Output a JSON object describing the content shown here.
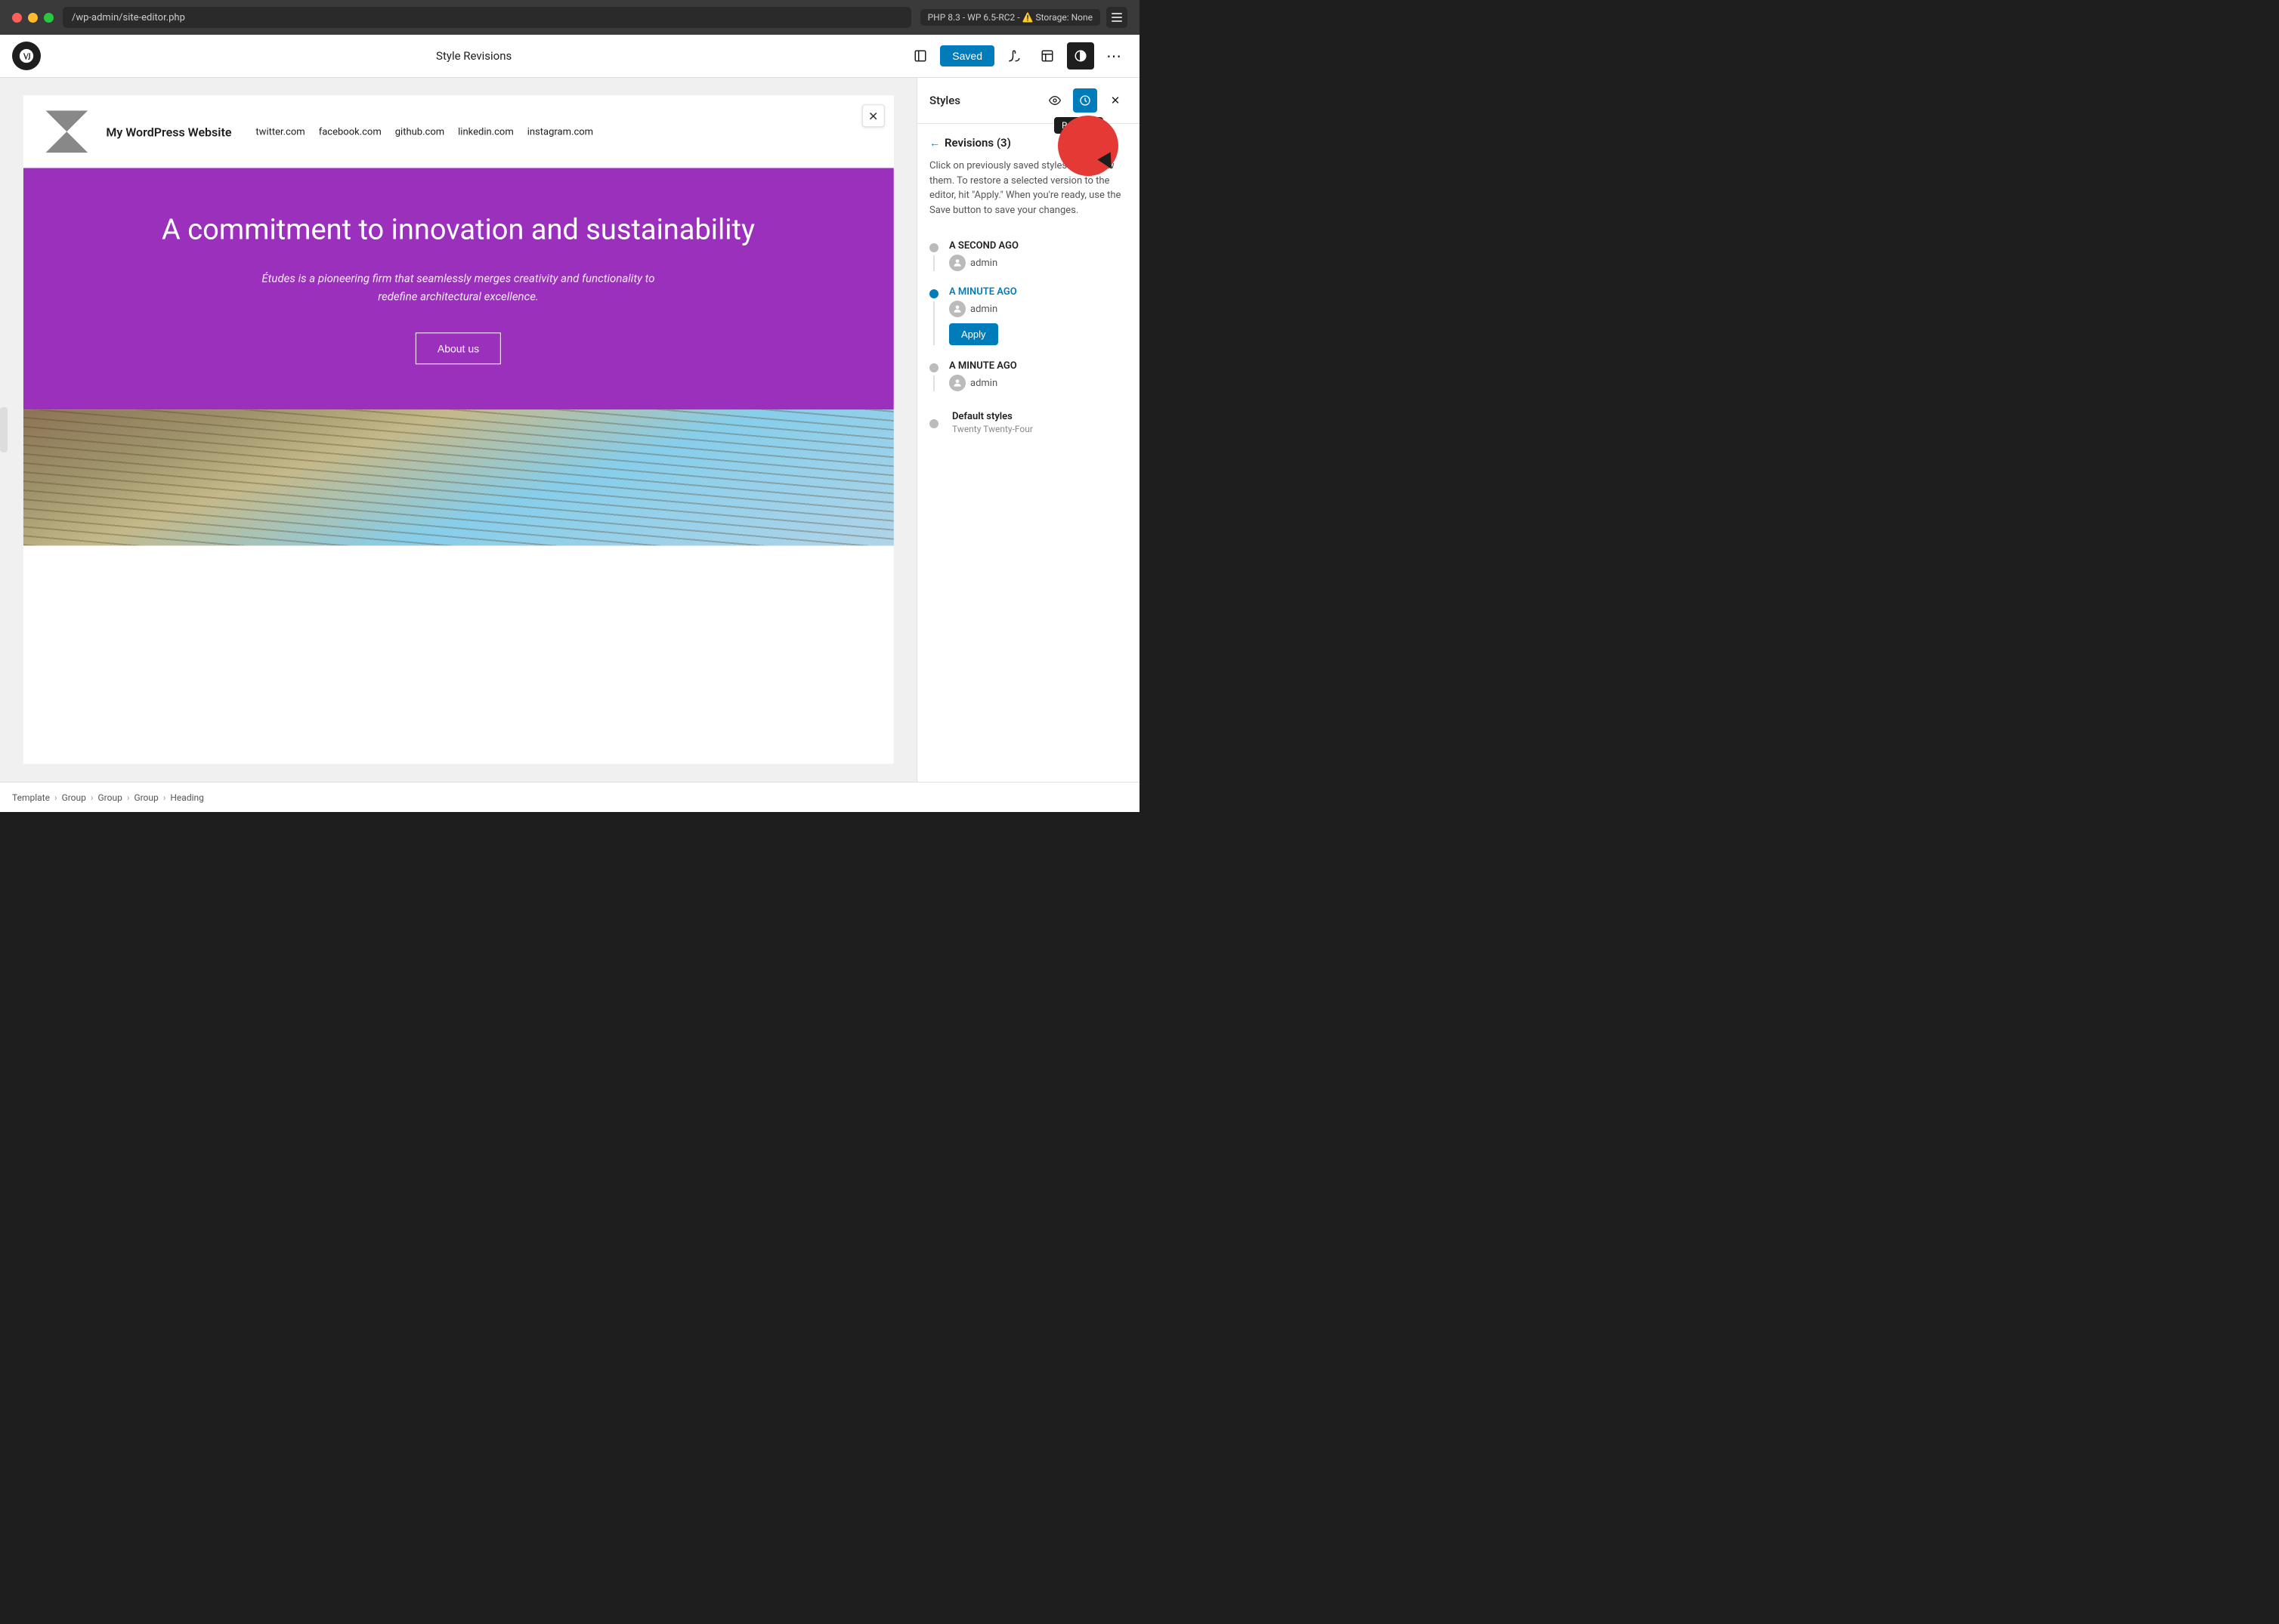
{
  "browser": {
    "address": "/wp-admin/site-editor.php",
    "php_badge": "PHP 8.3 - WP 6.5-RC2 - ⚠️ Storage: None"
  },
  "admin_bar": {
    "title": "Style Revisions",
    "saved_label": "Saved"
  },
  "toolbar": {
    "icons": [
      "view",
      "history",
      "styles",
      "layout",
      "contrast",
      "more"
    ]
  },
  "site_preview": {
    "logo_alt": "Site Logo",
    "site_title": "My WordPress Website",
    "nav_links": [
      "twitter.com",
      "facebook.com",
      "github.com",
      "linkedin.com",
      "instagram.com"
    ],
    "hero_title": "A commitment to innovation and sustainability",
    "hero_subtitle": "Études is a pioneering firm that seamlessly merges creativity and functionality to redefine architectural excellence.",
    "hero_cta": "About us"
  },
  "styles_panel": {
    "title": "Styles",
    "revisions_label": "Revisions (3)",
    "description": "Click on previously saved styles to preview them. To restore a selected version to the editor, hit \"Apply.\" When you're ready, use the Save button to save your changes.",
    "revisions": [
      {
        "time": "A SECOND AGO",
        "author": "admin",
        "active": false,
        "show_apply": false
      },
      {
        "time": "A MINUTE AGO",
        "author": "admin",
        "active": true,
        "show_apply": true,
        "apply_label": "Apply"
      },
      {
        "time": "A MINUTE AGO",
        "author": "admin",
        "active": false,
        "show_apply": false
      }
    ],
    "default_styles": {
      "title": "Default styles",
      "subtitle": "Twenty Twenty-Four"
    }
  },
  "revision_tooltip": "Revision",
  "breadcrumb": {
    "items": [
      "Template",
      "Group",
      "Group",
      "Group",
      "Heading"
    ],
    "separators": [
      ">",
      ">",
      ">",
      ">"
    ]
  }
}
